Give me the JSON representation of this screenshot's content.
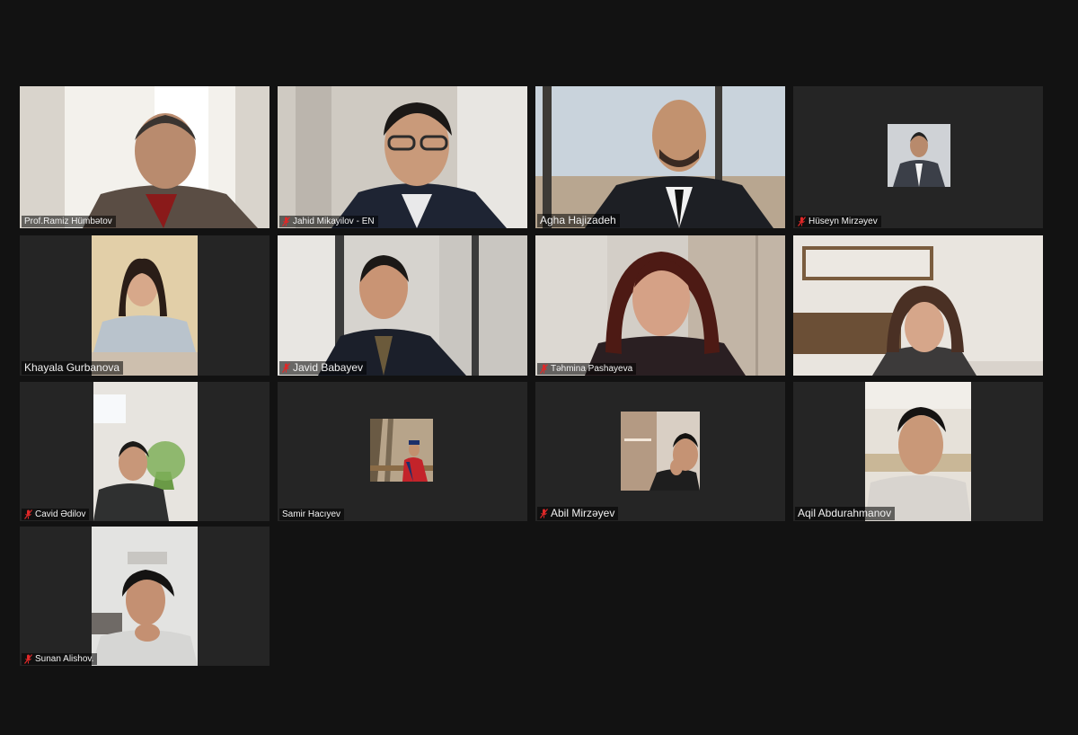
{
  "meeting": {
    "view": "gallery",
    "muted_icon": "mic-muted-icon",
    "participants": [
      {
        "name": "Prof.Ramiz Hümbətov",
        "muted": false
      },
      {
        "name": "Jahid Mikayilov - EN",
        "muted": true
      },
      {
        "name": "Agha Hajizadeh",
        "muted": false
      },
      {
        "name": "Hüseyn Mirzəyev",
        "muted": true
      },
      {
        "name": "Khayala Gurbanova",
        "muted": false
      },
      {
        "name": "Javid Babayev",
        "muted": true
      },
      {
        "name": "Təhmina Pashayeva",
        "muted": true
      },
      {
        "name": "",
        "muted": false
      },
      {
        "name": "Cavid Ədilov",
        "muted": true
      },
      {
        "name": "Samir Hacıyev",
        "muted": false
      },
      {
        "name": "Abil Mirzəyev",
        "muted": true
      },
      {
        "name": "Aqil Abdurahmanov",
        "muted": false
      },
      {
        "name": "Sunan Alishov.",
        "muted": true
      }
    ]
  },
  "colors": {
    "background": "#121212",
    "tile": "#252525",
    "muted_red": "#e02828",
    "label_text": "#f2f2f2"
  }
}
